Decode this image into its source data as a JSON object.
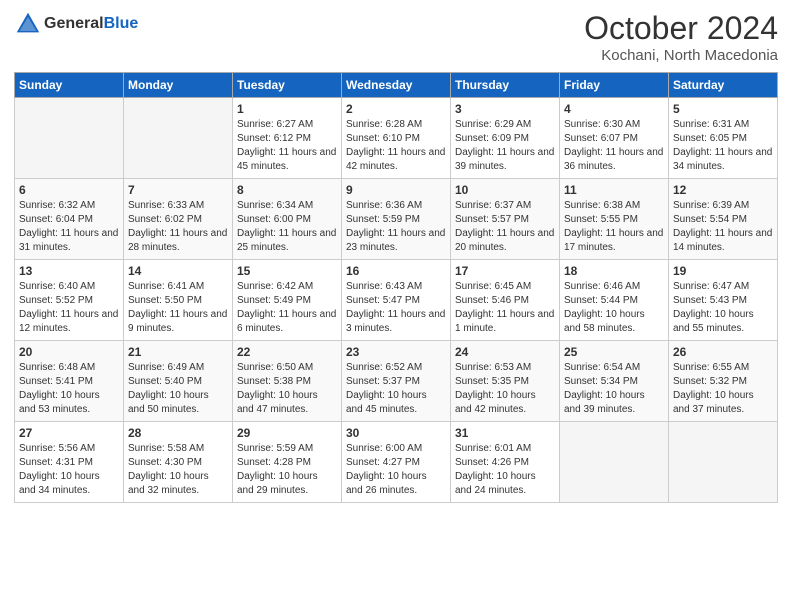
{
  "header": {
    "logo_general": "General",
    "logo_blue": "Blue",
    "month_year": "October 2024",
    "location": "Kochani, North Macedonia"
  },
  "days_of_week": [
    "Sunday",
    "Monday",
    "Tuesday",
    "Wednesday",
    "Thursday",
    "Friday",
    "Saturday"
  ],
  "weeks": [
    [
      {
        "day": "",
        "sunrise": "",
        "sunset": "",
        "daylight": ""
      },
      {
        "day": "",
        "sunrise": "",
        "sunset": "",
        "daylight": ""
      },
      {
        "day": "1",
        "sunrise": "Sunrise: 6:27 AM",
        "sunset": "Sunset: 6:12 PM",
        "daylight": "Daylight: 11 hours and 45 minutes."
      },
      {
        "day": "2",
        "sunrise": "Sunrise: 6:28 AM",
        "sunset": "Sunset: 6:10 PM",
        "daylight": "Daylight: 11 hours and 42 minutes."
      },
      {
        "day": "3",
        "sunrise": "Sunrise: 6:29 AM",
        "sunset": "Sunset: 6:09 PM",
        "daylight": "Daylight: 11 hours and 39 minutes."
      },
      {
        "day": "4",
        "sunrise": "Sunrise: 6:30 AM",
        "sunset": "Sunset: 6:07 PM",
        "daylight": "Daylight: 11 hours and 36 minutes."
      },
      {
        "day": "5",
        "sunrise": "Sunrise: 6:31 AM",
        "sunset": "Sunset: 6:05 PM",
        "daylight": "Daylight: 11 hours and 34 minutes."
      }
    ],
    [
      {
        "day": "6",
        "sunrise": "Sunrise: 6:32 AM",
        "sunset": "Sunset: 6:04 PM",
        "daylight": "Daylight: 11 hours and 31 minutes."
      },
      {
        "day": "7",
        "sunrise": "Sunrise: 6:33 AM",
        "sunset": "Sunset: 6:02 PM",
        "daylight": "Daylight: 11 hours and 28 minutes."
      },
      {
        "day": "8",
        "sunrise": "Sunrise: 6:34 AM",
        "sunset": "Sunset: 6:00 PM",
        "daylight": "Daylight: 11 hours and 25 minutes."
      },
      {
        "day": "9",
        "sunrise": "Sunrise: 6:36 AM",
        "sunset": "Sunset: 5:59 PM",
        "daylight": "Daylight: 11 hours and 23 minutes."
      },
      {
        "day": "10",
        "sunrise": "Sunrise: 6:37 AM",
        "sunset": "Sunset: 5:57 PM",
        "daylight": "Daylight: 11 hours and 20 minutes."
      },
      {
        "day": "11",
        "sunrise": "Sunrise: 6:38 AM",
        "sunset": "Sunset: 5:55 PM",
        "daylight": "Daylight: 11 hours and 17 minutes."
      },
      {
        "day": "12",
        "sunrise": "Sunrise: 6:39 AM",
        "sunset": "Sunset: 5:54 PM",
        "daylight": "Daylight: 11 hours and 14 minutes."
      }
    ],
    [
      {
        "day": "13",
        "sunrise": "Sunrise: 6:40 AM",
        "sunset": "Sunset: 5:52 PM",
        "daylight": "Daylight: 11 hours and 12 minutes."
      },
      {
        "day": "14",
        "sunrise": "Sunrise: 6:41 AM",
        "sunset": "Sunset: 5:50 PM",
        "daylight": "Daylight: 11 hours and 9 minutes."
      },
      {
        "day": "15",
        "sunrise": "Sunrise: 6:42 AM",
        "sunset": "Sunset: 5:49 PM",
        "daylight": "Daylight: 11 hours and 6 minutes."
      },
      {
        "day": "16",
        "sunrise": "Sunrise: 6:43 AM",
        "sunset": "Sunset: 5:47 PM",
        "daylight": "Daylight: 11 hours and 3 minutes."
      },
      {
        "day": "17",
        "sunrise": "Sunrise: 6:45 AM",
        "sunset": "Sunset: 5:46 PM",
        "daylight": "Daylight: 11 hours and 1 minute."
      },
      {
        "day": "18",
        "sunrise": "Sunrise: 6:46 AM",
        "sunset": "Sunset: 5:44 PM",
        "daylight": "Daylight: 10 hours and 58 minutes."
      },
      {
        "day": "19",
        "sunrise": "Sunrise: 6:47 AM",
        "sunset": "Sunset: 5:43 PM",
        "daylight": "Daylight: 10 hours and 55 minutes."
      }
    ],
    [
      {
        "day": "20",
        "sunrise": "Sunrise: 6:48 AM",
        "sunset": "Sunset: 5:41 PM",
        "daylight": "Daylight: 10 hours and 53 minutes."
      },
      {
        "day": "21",
        "sunrise": "Sunrise: 6:49 AM",
        "sunset": "Sunset: 5:40 PM",
        "daylight": "Daylight: 10 hours and 50 minutes."
      },
      {
        "day": "22",
        "sunrise": "Sunrise: 6:50 AM",
        "sunset": "Sunset: 5:38 PM",
        "daylight": "Daylight: 10 hours and 47 minutes."
      },
      {
        "day": "23",
        "sunrise": "Sunrise: 6:52 AM",
        "sunset": "Sunset: 5:37 PM",
        "daylight": "Daylight: 10 hours and 45 minutes."
      },
      {
        "day": "24",
        "sunrise": "Sunrise: 6:53 AM",
        "sunset": "Sunset: 5:35 PM",
        "daylight": "Daylight: 10 hours and 42 minutes."
      },
      {
        "day": "25",
        "sunrise": "Sunrise: 6:54 AM",
        "sunset": "Sunset: 5:34 PM",
        "daylight": "Daylight: 10 hours and 39 minutes."
      },
      {
        "day": "26",
        "sunrise": "Sunrise: 6:55 AM",
        "sunset": "Sunset: 5:32 PM",
        "daylight": "Daylight: 10 hours and 37 minutes."
      }
    ],
    [
      {
        "day": "27",
        "sunrise": "Sunrise: 5:56 AM",
        "sunset": "Sunset: 4:31 PM",
        "daylight": "Daylight: 10 hours and 34 minutes."
      },
      {
        "day": "28",
        "sunrise": "Sunrise: 5:58 AM",
        "sunset": "Sunset: 4:30 PM",
        "daylight": "Daylight: 10 hours and 32 minutes."
      },
      {
        "day": "29",
        "sunrise": "Sunrise: 5:59 AM",
        "sunset": "Sunset: 4:28 PM",
        "daylight": "Daylight: 10 hours and 29 minutes."
      },
      {
        "day": "30",
        "sunrise": "Sunrise: 6:00 AM",
        "sunset": "Sunset: 4:27 PM",
        "daylight": "Daylight: 10 hours and 26 minutes."
      },
      {
        "day": "31",
        "sunrise": "Sunrise: 6:01 AM",
        "sunset": "Sunset: 4:26 PM",
        "daylight": "Daylight: 10 hours and 24 minutes."
      },
      {
        "day": "",
        "sunrise": "",
        "sunset": "",
        "daylight": ""
      },
      {
        "day": "",
        "sunrise": "",
        "sunset": "",
        "daylight": ""
      }
    ]
  ]
}
